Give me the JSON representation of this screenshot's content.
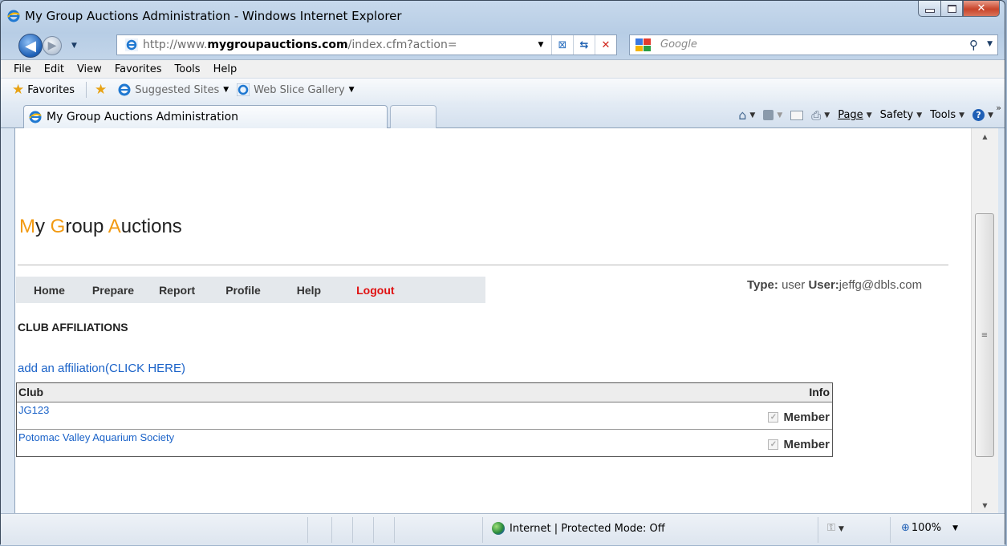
{
  "window": {
    "title": "My Group Auctions Administration - Windows Internet Explorer"
  },
  "address_bar": {
    "url_prefix": "http://www.",
    "url_domain": "mygroupauctions.com",
    "url_rest": "/index.cfm?action="
  },
  "search": {
    "placeholder": "Google"
  },
  "menu": [
    "File",
    "Edit",
    "View",
    "Favorites",
    "Tools",
    "Help"
  ],
  "favorites_bar": {
    "favorites_label": "Favorites",
    "suggested_sites": "Suggested Sites",
    "web_slice_gallery": "Web Slice Gallery"
  },
  "tab": {
    "label": "My Group Auctions Administration"
  },
  "command_bar": {
    "page": "Page",
    "safety": "Safety",
    "tools": "Tools"
  },
  "page": {
    "title_parts": [
      {
        "text": "M",
        "accent": true
      },
      {
        "text": "y ",
        "accent": false
      },
      {
        "text": "G",
        "accent": true
      },
      {
        "text": "roup ",
        "accent": false
      },
      {
        "text": "A",
        "accent": true
      },
      {
        "text": "uctions",
        "accent": false
      }
    ],
    "accent_color": "#f29a12",
    "nav": [
      {
        "label": "Home",
        "color": "#333333"
      },
      {
        "label": "Prepare",
        "color": "#333333"
      },
      {
        "label": "Report",
        "color": "#333333"
      },
      {
        "label": "Profile",
        "color": "#333333"
      },
      {
        "label": "Help",
        "color": "#333333"
      },
      {
        "label": "Logout",
        "color": "#e01010"
      }
    ],
    "user_type_label": "Type:",
    "user_type": "user",
    "user_label": "User:",
    "user_email": "jeffg@dbls.com",
    "section_heading": "CLUB AFFILIATIONS",
    "add_link": "add an affiliation(CLICK HERE)",
    "table": {
      "headers": {
        "club": "Club",
        "info": "Info"
      },
      "rows": [
        {
          "club": "JG123",
          "info": "Member",
          "checked": true
        },
        {
          "club": "Potomac Valley Aquarium Society",
          "info": "Member",
          "checked": true
        }
      ]
    }
  },
  "status_bar": {
    "zone": "Internet | Protected Mode: Off",
    "zoom": "100%"
  }
}
